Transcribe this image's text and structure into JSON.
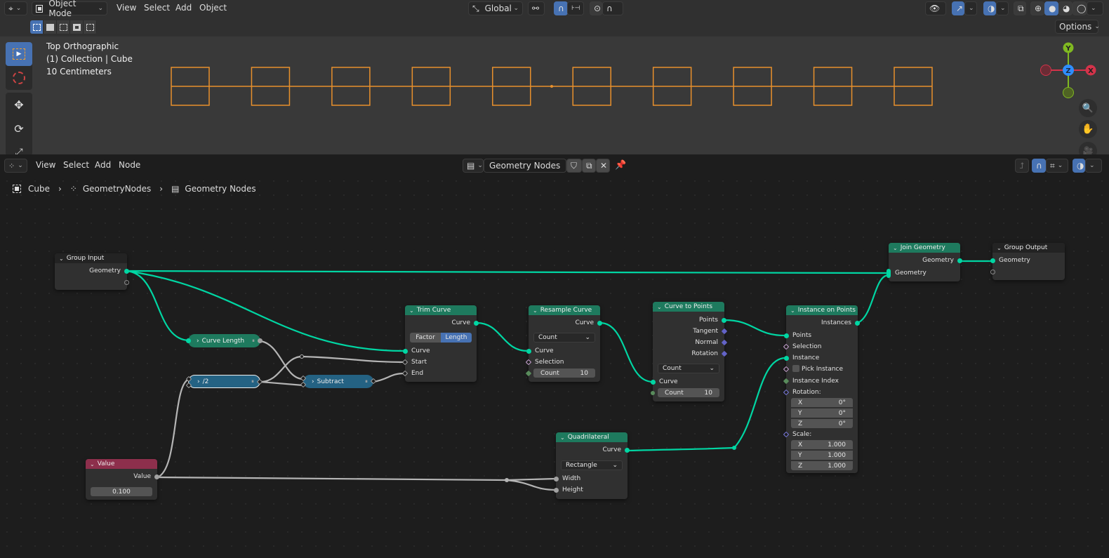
{
  "viewport_header": {
    "editor_type_icon": "3d-viewport-icon",
    "mode": "Object Mode",
    "menus": [
      "View",
      "Select",
      "Add",
      "Object"
    ],
    "transform_orientation": "Global",
    "options_label": "Options"
  },
  "viewport": {
    "view_name": "Top Orthographic",
    "collection_info": "(1) Collection | Cube",
    "scale_info": "10 Centimeters",
    "gizmo_axes": {
      "x": "X",
      "y": "Y",
      "z": "Z"
    },
    "colors": {
      "selection": "#e8902c",
      "x_axis": "#d4334a",
      "y_axis": "#80b921",
      "z_axis": "#2f8eff"
    },
    "instance_count": 10
  },
  "node_header": {
    "menus": [
      "View",
      "Select",
      "Add",
      "Node"
    ],
    "node_tree_name": "Geometry Nodes"
  },
  "breadcrumb": [
    "Cube",
    "GeometryNodes",
    "Geometry Nodes"
  ],
  "nodes": {
    "group_input": {
      "title": "Group Input",
      "outputs": [
        "Geometry"
      ]
    },
    "curve_length": {
      "title": "Curve Length"
    },
    "divide": {
      "title": "/2"
    },
    "subtract": {
      "title": "Subtract"
    },
    "value": {
      "title": "Value",
      "output": "Value",
      "value": "0.100"
    },
    "trim_curve": {
      "title": "Trim Curve",
      "output": "Curve",
      "modes": [
        "Factor",
        "Length"
      ],
      "active_mode": "Length",
      "inputs": [
        "Curve",
        "Start",
        "End"
      ]
    },
    "resample_curve": {
      "title": "Resample Curve",
      "output": "Curve",
      "mode": "Count",
      "inputs": [
        "Curve",
        "Selection"
      ],
      "count_label": "Count",
      "count_value": "10"
    },
    "curve_to_points": {
      "title": "Curve to Points",
      "outputs": [
        "Points",
        "Tangent",
        "Normal",
        "Rotation"
      ],
      "mode": "Count",
      "input": "Curve",
      "count_label": "Count",
      "count_value": "10"
    },
    "quadrilateral": {
      "title": "Quadrilateral",
      "output": "Curve",
      "mode": "Rectangle",
      "inputs": [
        "Width",
        "Height"
      ]
    },
    "instance_on_points": {
      "title": "Instance on Points",
      "output": "Instances",
      "inputs": [
        "Points",
        "Selection",
        "Instance",
        "Pick Instance",
        "Instance Index"
      ],
      "rotation_label": "Rotation:",
      "rotation": [
        {
          "axis": "X",
          "value": "0°"
        },
        {
          "axis": "Y",
          "value": "0°"
        },
        {
          "axis": "Z",
          "value": "0°"
        }
      ],
      "scale_label": "Scale:",
      "scale": [
        {
          "axis": "X",
          "value": "1.000"
        },
        {
          "axis": "Y",
          "value": "1.000"
        },
        {
          "axis": "Z",
          "value": "1.000"
        }
      ]
    },
    "join_geometry": {
      "title": "Join Geometry",
      "output": "Geometry",
      "input": "Geometry"
    },
    "group_output": {
      "title": "Group Output",
      "input": "Geometry"
    }
  },
  "colors": {
    "geometry_link": "#00d6a3",
    "float_link": "#b5b5b5",
    "node_green": "#1e7a5e",
    "node_value": "#8d2f4c",
    "node_math": "#246283",
    "active_blue": "#4772b3"
  }
}
